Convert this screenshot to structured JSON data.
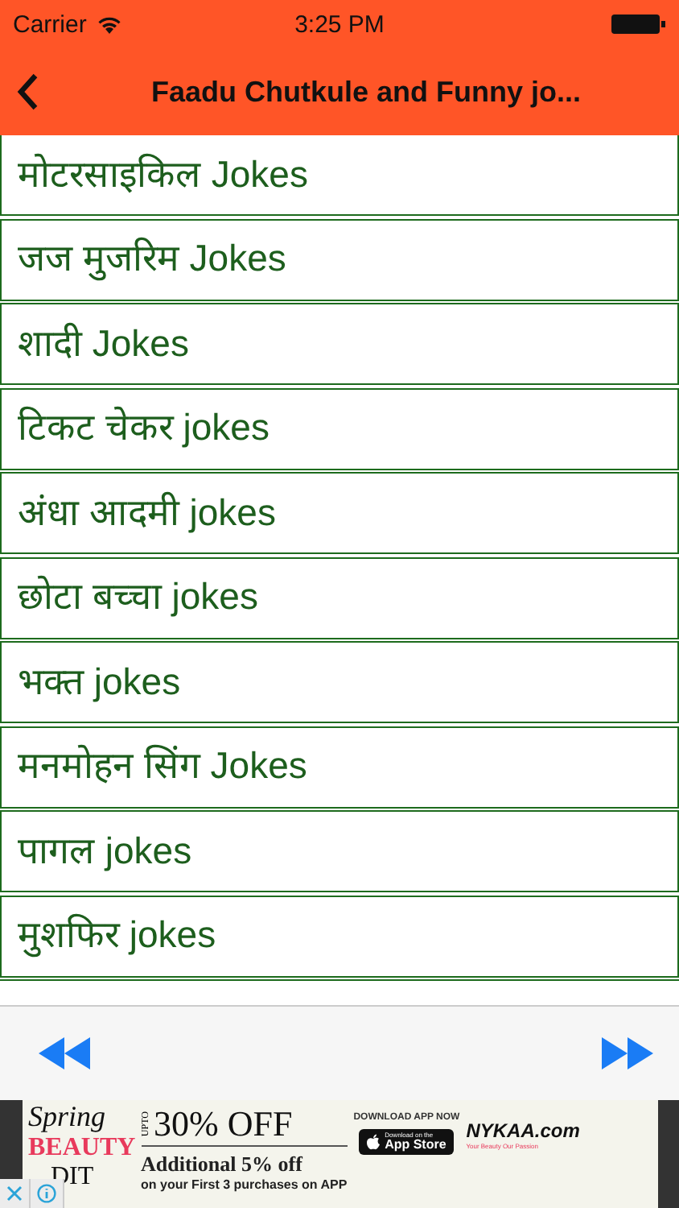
{
  "status_bar": {
    "carrier": "Carrier",
    "time": "3:25 PM"
  },
  "nav_bar": {
    "title": "Faadu Chutkule and Funny jo..."
  },
  "categories": [
    {
      "label": "मोटरसाइकिल Jokes"
    },
    {
      "label": "जज मुजरिम Jokes"
    },
    {
      "label": "शादी Jokes"
    },
    {
      "label": "टिकट चेकर jokes"
    },
    {
      "label": "अंधा आदमी jokes"
    },
    {
      "label": "छोटा बच्चा jokes"
    },
    {
      "label": "भक्त jokes"
    },
    {
      "label": "मनमोहन सिंग Jokes"
    },
    {
      "label": "पागल jokes"
    },
    {
      "label": "मुशफिर jokes"
    }
  ],
  "ad": {
    "spring": "Spring",
    "beauty": "BEAUTY",
    "edit": "DIT",
    "upto": "UPTO",
    "discount": "30% OFF",
    "extra": "Additional 5% off",
    "terms": "on your First 3 purchases on APP",
    "download": "DOWNLOAD APP NOW",
    "store_small": "Download on the",
    "store": "App Store",
    "brand": "NYKAA.com",
    "tagline": "Your Beauty Our Passion"
  }
}
